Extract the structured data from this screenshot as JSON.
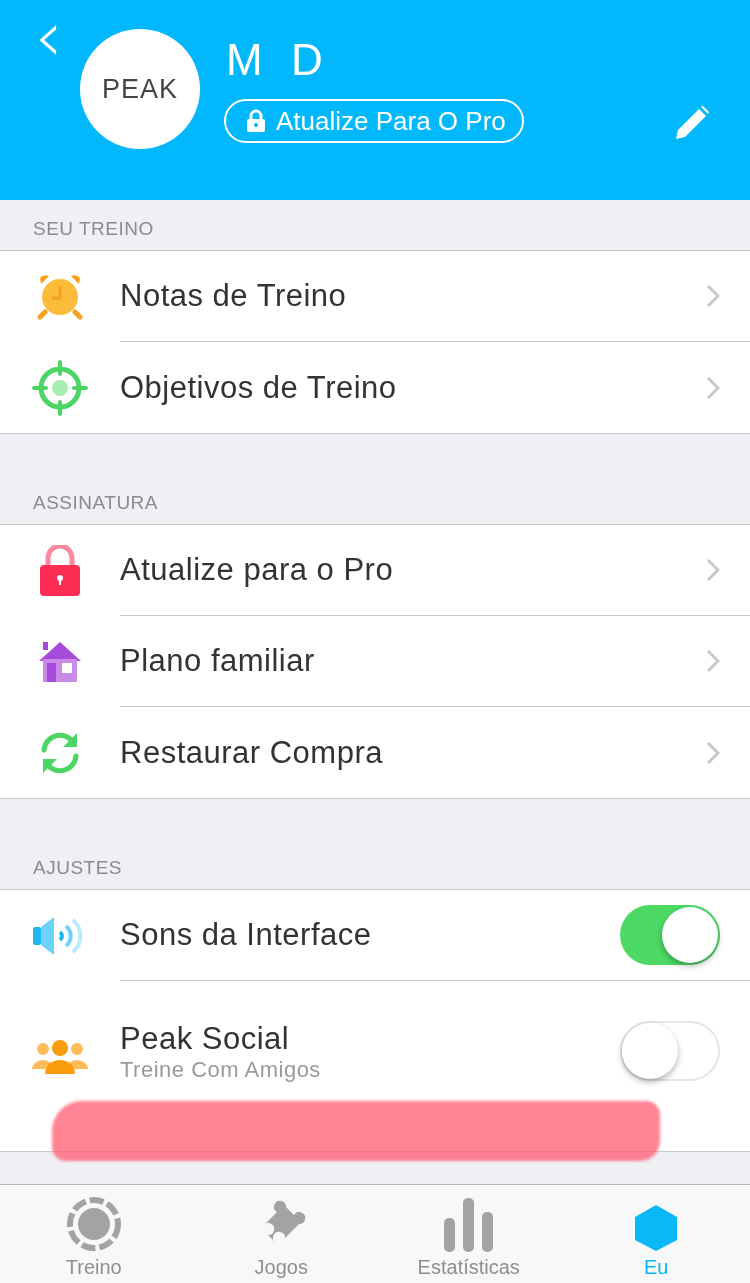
{
  "header": {
    "back": "‹",
    "name": "M D",
    "logo": "PEAK",
    "upgrade_button": "Atualize Para O Pro"
  },
  "sections": [
    {
      "title": "SEU TREINO",
      "rows": [
        {
          "kind": "link",
          "label": "Notas de Treino"
        },
        {
          "kind": "link",
          "label": "Objetivos de Treino"
        }
      ]
    },
    {
      "title": "ASSINATURA",
      "rows": [
        {
          "kind": "link",
          "label": "Atualize para o Pro"
        },
        {
          "kind": "link",
          "label": "Plano familiar"
        },
        {
          "kind": "link",
          "label": "Restaurar Compra"
        }
      ]
    },
    {
      "title": "AJUSTES",
      "rows": [
        {
          "kind": "toggle",
          "label": "Sons da Interface",
          "on": true
        },
        {
          "kind": "toggle",
          "label": "Peak Social",
          "subtitle": "Treine Com Amigos",
          "on": false
        }
      ]
    }
  ],
  "tabs": [
    {
      "label": "Treino",
      "selected": false
    },
    {
      "label": "Jogos",
      "selected": false
    },
    {
      "label": "Estatísticas",
      "selected": false
    },
    {
      "label": "Eu",
      "selected": true
    }
  ]
}
